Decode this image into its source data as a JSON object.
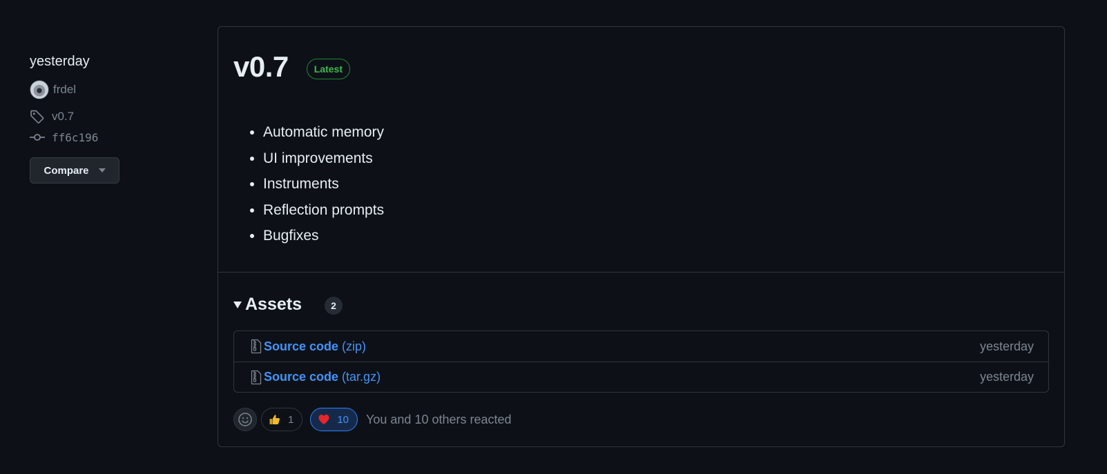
{
  "meta": {
    "date": "yesterday",
    "author": "frdel",
    "tag": "v0.7",
    "commit": "ff6c196",
    "compare_label": "Compare"
  },
  "release": {
    "title": "v0.7",
    "badge": "Latest",
    "notes": [
      "Automatic memory",
      "UI improvements",
      "Instruments",
      "Reflection prompts",
      "Bugfixes"
    ]
  },
  "assets": {
    "title": "Assets",
    "count": "2",
    "items": [
      {
        "name": "Source code",
        "ext": "(zip)",
        "date": "yesterday"
      },
      {
        "name": "Source code",
        "ext": "(tar.gz)",
        "date": "yesterday"
      }
    ]
  },
  "reactions": {
    "thumbs_up_count": "1",
    "heart_count": "10",
    "summary": "You and 10 others reacted"
  },
  "colors": {
    "background": "#0d1117",
    "border": "#30363d",
    "link": "#4493f8",
    "latest_green": "#3fb950",
    "muted": "#7d8590"
  },
  "icons": [
    "tag-icon",
    "git-commit-icon",
    "file-zip-icon",
    "smiley-icon",
    "thumbs-up-icon",
    "heart-icon"
  ]
}
